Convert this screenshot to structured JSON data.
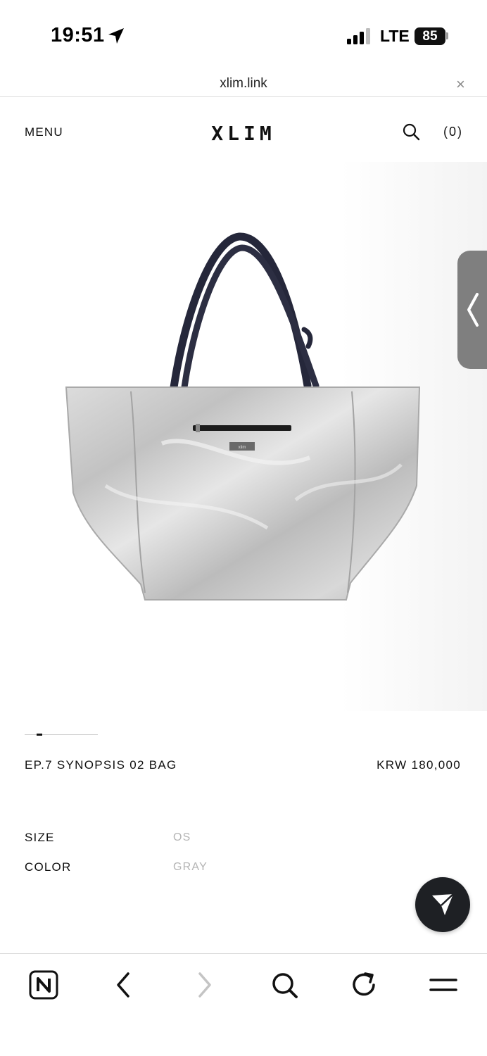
{
  "status_bar": {
    "time": "19:51",
    "network": "LTE",
    "battery": "85"
  },
  "browser": {
    "url": "xlim.link",
    "close_glyph": "×"
  },
  "header": {
    "menu_label": "MENU",
    "logo": "XLIM",
    "cart_label": "(0)"
  },
  "product": {
    "name": "EP.7 SYNOPSIS 02 BAG",
    "price": "KRW 180,000",
    "bag_tag": "xlim",
    "attributes": [
      {
        "label": "SIZE",
        "value": "OS"
      },
      {
        "label": "COLOR",
        "value": "GRAY"
      }
    ]
  },
  "icons": {
    "location": "location-arrow-icon",
    "signal": "signal-bars-icon",
    "search": "search-icon",
    "side": "chevron-left-icon",
    "fab": "send-icon",
    "toolbar": [
      "n-home-icon",
      "back-icon",
      "forward-icon",
      "search-icon",
      "reload-icon",
      "menu-icon"
    ]
  },
  "colors": {
    "accent_dark": "#1e2024",
    "muted_value": "#b4b4b4",
    "side_handle": "#7f7f7f"
  }
}
